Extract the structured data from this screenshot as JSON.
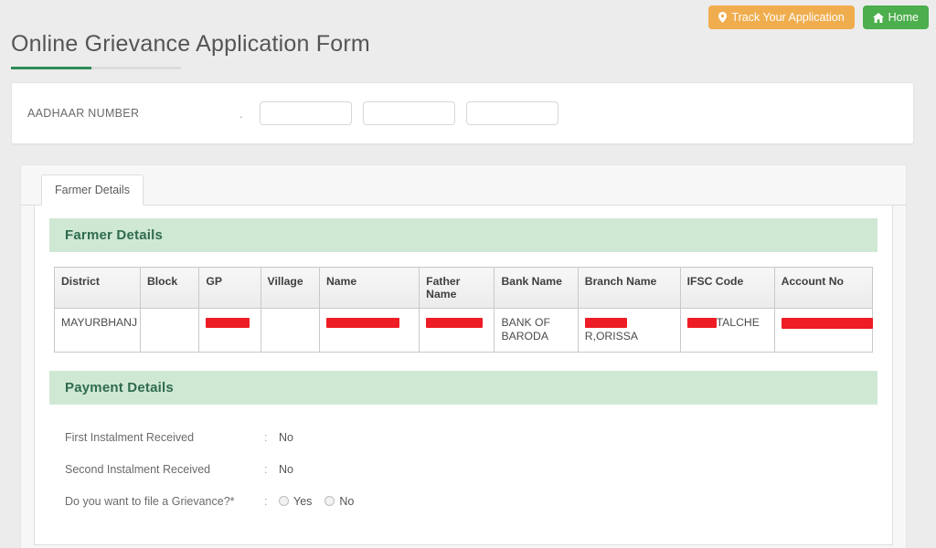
{
  "topbar": {
    "track_label": "Track Your Application",
    "track_icon": "map-pin-icon",
    "track_color": "#f0ad4e",
    "home_label": "Home",
    "home_icon": "home-icon",
    "home_color": "#4cae4c"
  },
  "page": {
    "title": "Online Grievance Application Form",
    "accent_color": "#2e8b57"
  },
  "aadhaar": {
    "label": "AADHAAR NUMBER",
    "separator": ".",
    "fields": [
      {
        "name": "aadhaar-part-1",
        "value": "",
        "placeholder": ""
      },
      {
        "name": "aadhaar-part-2",
        "value": "",
        "placeholder": ""
      },
      {
        "name": "aadhaar-part-3",
        "value": "",
        "placeholder": ""
      }
    ]
  },
  "tabs": [
    {
      "label": "Farmer Details",
      "active": true
    }
  ],
  "farmer_section": {
    "heading": "Farmer Details",
    "columns": [
      "District",
      "Block",
      "GP",
      "Village",
      "Name",
      "Father Name",
      "Bank Name",
      "Branch Name",
      "IFSC Code",
      "Account No"
    ],
    "rows": [
      {
        "district": "MAYURBHANJ",
        "block": "",
        "gp": "",
        "gp_redacted": true,
        "village": "",
        "name": "",
        "name_redacted": true,
        "father_name": "",
        "father_name_redacted": true,
        "bank_name": "BANK OF BARODA",
        "branch_name": "R,ORISSA",
        "branch_name_redacted": true,
        "ifsc_code": "TALCHE",
        "ifsc_code_redacted": true,
        "account_no": "",
        "account_no_redacted": true
      }
    ]
  },
  "payment_section": {
    "heading": "Payment Details",
    "separator": ":",
    "rows": [
      {
        "label": "First Instalment Received",
        "value": "No",
        "type": "text"
      },
      {
        "label": "Second Instalment Received",
        "value": "No",
        "type": "text"
      }
    ],
    "grievance": {
      "label": "Do you want to file a Grievance?*",
      "options": [
        {
          "label": "Yes",
          "selected": false
        },
        {
          "label": "No",
          "selected": false
        }
      ]
    }
  }
}
